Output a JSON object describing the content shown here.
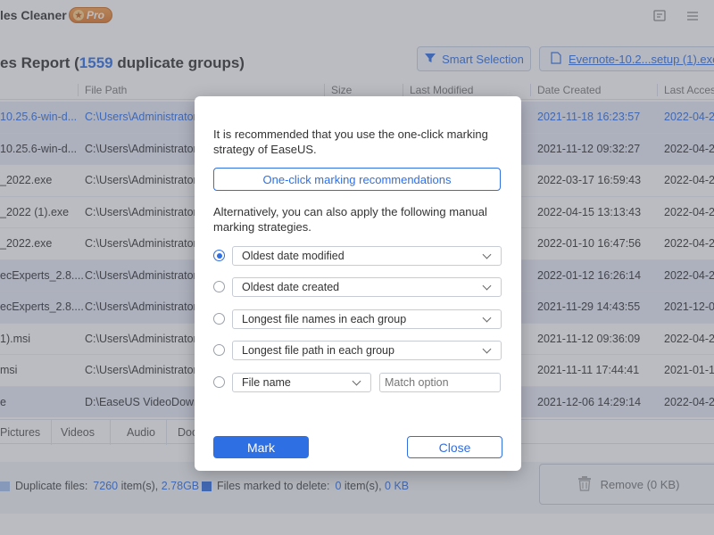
{
  "app": {
    "title": "les Cleaner",
    "pro_label": "Pro",
    "header_icons": [
      "feedback-icon",
      "menu-icon"
    ]
  },
  "report": {
    "title_prefix": "es Report (",
    "group_count": "1559",
    "title_suffix": " duplicate groups)",
    "smart_selection_label": "Smart Selection",
    "file_label": "Evernote-10.2...setup (1).exe"
  },
  "table": {
    "columns": [
      "File Path",
      "Size",
      "Last Modified",
      "Date Created",
      "Last Acces"
    ],
    "rows": [
      {
        "name": "10.25.6-win-d...",
        "path": "C:\\Users\\Administrator",
        "created": "2021-11-18 16:23:57",
        "accessed": "2022-04-2",
        "shaded": true,
        "blue": true
      },
      {
        "name": "10.25.6-win-d...",
        "path": "C:\\Users\\Administrator",
        "created": "2021-11-12 09:32:27",
        "accessed": "2022-04-2",
        "shaded": true,
        "blue": false
      },
      {
        "name": "_2022.exe",
        "path": "C:\\Users\\Administrator",
        "created": "2022-03-17 16:59:43",
        "accessed": "2022-04-2",
        "shaded": false,
        "blue": false
      },
      {
        "name": "_2022 (1).exe",
        "path": "C:\\Users\\Administrator",
        "created": "2022-04-15 13:13:43",
        "accessed": "2022-04-2",
        "shaded": false,
        "blue": false
      },
      {
        "name": "_2022.exe",
        "path": "C:\\Users\\Administrator",
        "created": "2022-01-10 16:47:56",
        "accessed": "2022-04-2",
        "shaded": false,
        "blue": false
      },
      {
        "name": "ecExperts_2.8....",
        "path": "C:\\Users\\Administrator",
        "created": "2022-01-12 16:26:14",
        "accessed": "2022-04-2",
        "shaded": true,
        "blue": false
      },
      {
        "name": "ecExperts_2.8....",
        "path": "C:\\Users\\Administrator",
        "created": "2021-11-29 14:43:55",
        "accessed": "2021-12-0",
        "shaded": true,
        "blue": false
      },
      {
        "name": "1).msi",
        "path": "C:\\Users\\Administrator",
        "created": "2021-11-12 09:36:09",
        "accessed": "2022-04-2",
        "shaded": false,
        "blue": false
      },
      {
        "name": "msi",
        "path": "C:\\Users\\Administrator",
        "created": "2021-11-11 17:44:41",
        "accessed": "2021-01-1",
        "shaded": false,
        "blue": false
      },
      {
        "name": "e",
        "path": "D:\\EaseUS VideoDown",
        "created": "2021-12-06 14:29:14",
        "accessed": "2022-04-2",
        "shaded": true,
        "blue": false
      }
    ]
  },
  "tabs": [
    "Pictures",
    "Videos",
    "Audio",
    "Doc"
  ],
  "footer": {
    "duplicate_label": "Duplicate files:",
    "duplicate_count": "7260",
    "duplicate_unit": "item(s),",
    "duplicate_size": "2.78GB",
    "marked_label": "Files marked to delete:",
    "marked_count": "0",
    "marked_unit": "item(s),",
    "marked_size": "0 KB",
    "remove_label": "Remove (0 KB)"
  },
  "modal": {
    "intro": "It is recommended that you use the one-click marking strategy of EaseUS.",
    "oneclick_label": "One-click marking recommendations",
    "alt_text": "Alternatively, you can also apply the following manual marking strategies.",
    "options": [
      {
        "label": "Oldest date modified",
        "checked": true
      },
      {
        "label": "Oldest date created",
        "checked": false
      },
      {
        "label": "Longest file names in each group",
        "checked": false
      },
      {
        "label": "Longest file path in each group",
        "checked": false
      }
    ],
    "filename_option": {
      "label": "File name",
      "placeholder": "Match option"
    },
    "mark_label": "Mark",
    "close_label": "Close"
  },
  "colors": {
    "accent": "#2f6fe4",
    "overlay": "rgba(90,96,110,0.42)",
    "marked_square": "#2f6fe4",
    "duplicate_square": "#a8c3f2"
  }
}
